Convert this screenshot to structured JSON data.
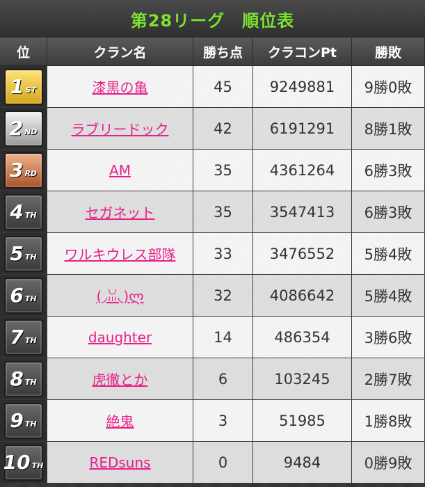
{
  "title": "第28リーグ　順位表",
  "headers": [
    "位",
    "クラン名",
    "勝ち点",
    "クラコンPt",
    "勝敗"
  ],
  "colors": {
    "title_green": "#7fe03a",
    "link_pink": "#e6208a",
    "gold": "#f0c53a",
    "silver": "#cfcfcf",
    "bronze": "#d07a4a"
  },
  "rows": [
    {
      "rank": "1",
      "suffix": "ST",
      "badge": "gold",
      "clan": "漆黒の亀",
      "points": "45",
      "pt": "9249881",
      "record": "9勝0敗"
    },
    {
      "rank": "2",
      "suffix": "ND",
      "badge": "silver",
      "clan": "ラブリードック",
      "points": "42",
      "pt": "6191291",
      "record": "8勝1敗"
    },
    {
      "rank": "3",
      "suffix": "RD",
      "badge": "bronze",
      "clan": "AM",
      "points": "35",
      "pt": "4361264",
      "record": "6勝3敗"
    },
    {
      "rank": "4",
      "suffix": "TH",
      "badge": "dark",
      "clan": "セガネット",
      "points": "35",
      "pt": "3547413",
      "record": "6勝3敗"
    },
    {
      "rank": "5",
      "suffix": "TH",
      "badge": "dark",
      "clan": "ワルキウレス部隊",
      "points": "33",
      "pt": "3476552",
      "record": "5勝4敗"
    },
    {
      "rank": "6",
      "suffix": "TH",
      "badge": "dark",
      "clan": "(◞ꈍ◟)ლ",
      "points": "32",
      "pt": "4086642",
      "record": "5勝4敗"
    },
    {
      "rank": "7",
      "suffix": "TH",
      "badge": "dark",
      "clan": "daughter",
      "points": "14",
      "pt": "486354",
      "record": "3勝6敗"
    },
    {
      "rank": "8",
      "suffix": "TH",
      "badge": "dark",
      "clan": "虎徹とか",
      "points": "6",
      "pt": "103245",
      "record": "2勝7敗"
    },
    {
      "rank": "9",
      "suffix": "TH",
      "badge": "dark",
      "clan": "絶鬼",
      "points": "3",
      "pt": "51985",
      "record": "1勝8敗"
    },
    {
      "rank": "10",
      "suffix": "TH",
      "badge": "dark",
      "clan": "REDsuns",
      "points": "0",
      "pt": "9484",
      "record": "0勝9敗"
    }
  ]
}
